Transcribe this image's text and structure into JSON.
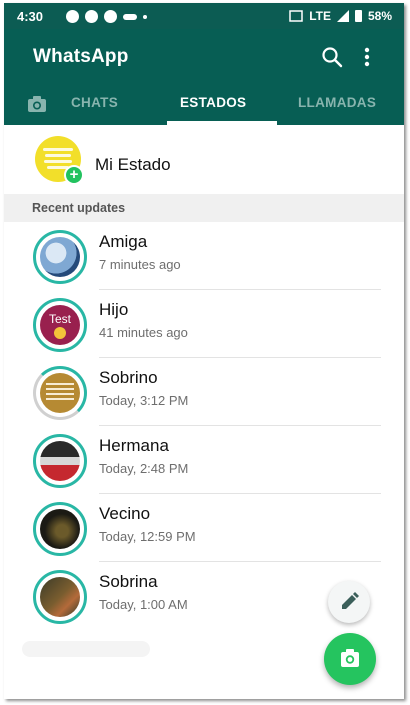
{
  "status_bar": {
    "time": "4:30",
    "network": "LTE",
    "battery": "58%"
  },
  "app": {
    "title": "WhatsApp",
    "accent_color": "#075e54",
    "fab_color": "#25c45f"
  },
  "tabs": [
    {
      "label": "CHATS",
      "active": false
    },
    {
      "label": "ESTADOS",
      "active": true
    },
    {
      "label": "LLAMADAS",
      "active": false
    }
  ],
  "my_status": {
    "name": "Mi Estado",
    "badge": "+"
  },
  "section": {
    "recent_label": "Recent updates"
  },
  "status_items": [
    {
      "name": "Amiga",
      "time": "7 minutes ago"
    },
    {
      "name": "Hijo",
      "time": "41 minutes ago",
      "thumb_text": "Test"
    },
    {
      "name": "Sobrino",
      "time": "Today, 3:12 PM"
    },
    {
      "name": "Hermana",
      "time": "Today, 2:48 PM"
    },
    {
      "name": "Vecino",
      "time": "Today, 12:59 PM"
    },
    {
      "name": "Sobrina",
      "time": "Today, 1:00 AM"
    }
  ],
  "icons": {
    "search": "search-icon",
    "menu": "more-vert-icon",
    "camera_tab": "camera-icon",
    "edit_fab": "pencil-icon",
    "camera_fab": "camera-icon"
  }
}
